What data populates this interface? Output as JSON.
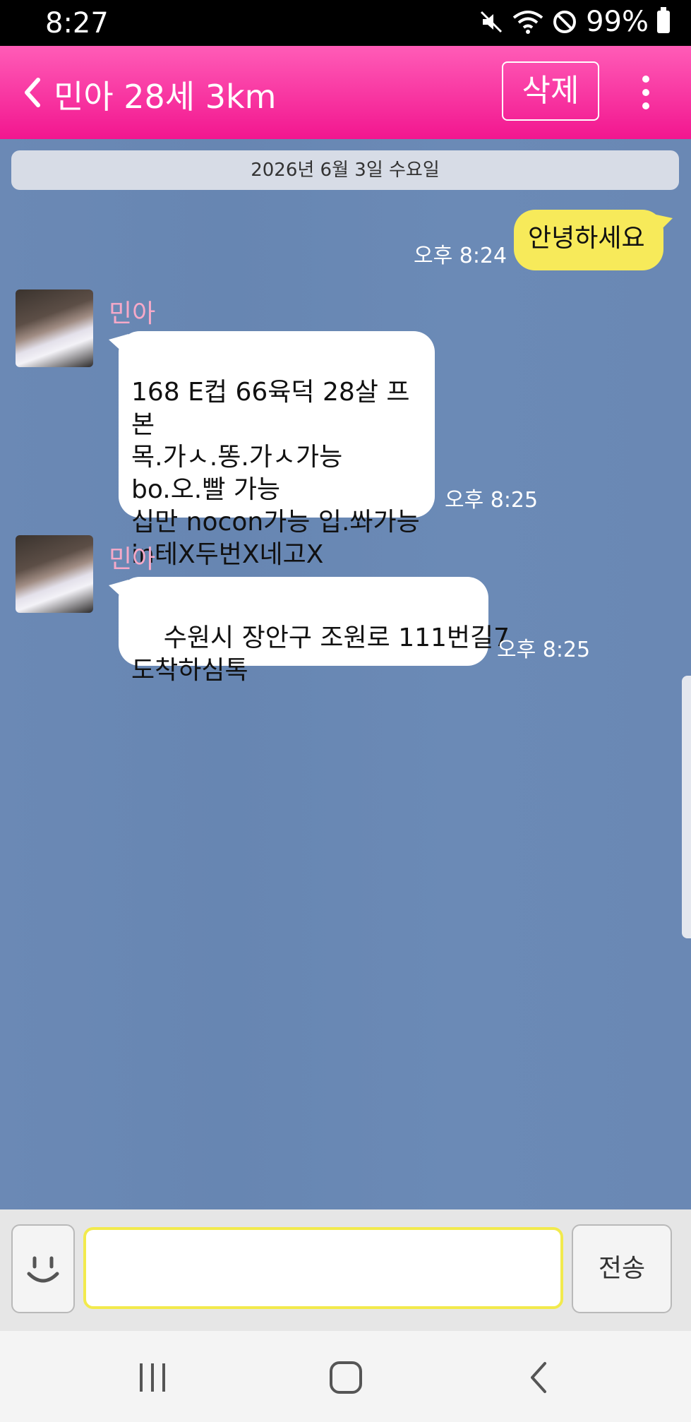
{
  "status_bar": {
    "time": "8:27",
    "battery": "99%",
    "icons": [
      "mute-icon",
      "wifi-icon",
      "block-icon",
      "battery-icon"
    ]
  },
  "header": {
    "title": "민아 28세 3km",
    "delete_label": "삭제",
    "accent_color": "#f2168f"
  },
  "chat": {
    "date": "2026년 6월 3일 수요일",
    "messages": [
      {
        "from": "me",
        "text": "안녕하세요",
        "time": "오후 8:24"
      },
      {
        "from": "민아",
        "sender": "민아",
        "text": "168 E컵 66육덕 28살 프본\n목.가ㅅ.똥.가ㅅ가능\nbo.오.빨 가능\n십만 nocon가능 입.쏴가능\nin테X두번X네고X",
        "time": "오후 8:25"
      },
      {
        "from": "민아",
        "sender": "민아",
        "text": "수원시 장안구 조원로 111번길7\n도착하심톡",
        "time": "오후 8:25"
      }
    ],
    "my_bubble_color": "#f7ea5a",
    "their_bubble_color": "#ffffff",
    "background_color": "#6a88b4"
  },
  "input": {
    "value": "",
    "placeholder": "",
    "send_label": "전송"
  },
  "nav": {
    "icons": [
      "recent-apps-icon",
      "home-icon",
      "back-icon"
    ]
  }
}
